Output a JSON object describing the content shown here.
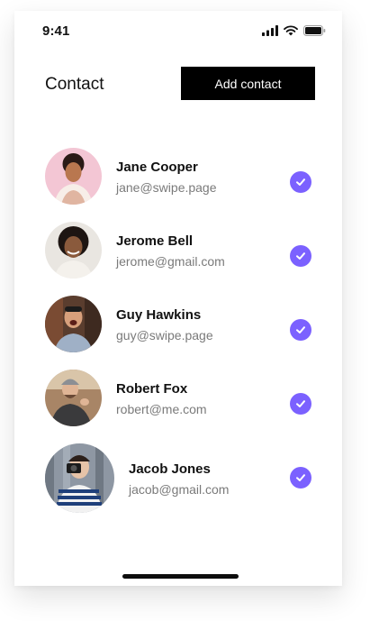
{
  "status_bar": {
    "time": "9:41"
  },
  "header": {
    "title": "Contact",
    "add_button_label": "Add contact"
  },
  "accent_color": "#7b61ff",
  "contacts": [
    {
      "name": "Jane Cooper",
      "email": "jane@swipe.page",
      "selected": true
    },
    {
      "name": "Jerome Bell",
      "email": "jerome@gmail.com",
      "selected": true
    },
    {
      "name": "Guy Hawkins",
      "email": "guy@swipe.page",
      "selected": true
    },
    {
      "name": "Robert Fox",
      "email": "robert@me.com",
      "selected": true
    },
    {
      "name": "Jacob Jones",
      "email": "jacob@gmail.com",
      "selected": true
    }
  ]
}
